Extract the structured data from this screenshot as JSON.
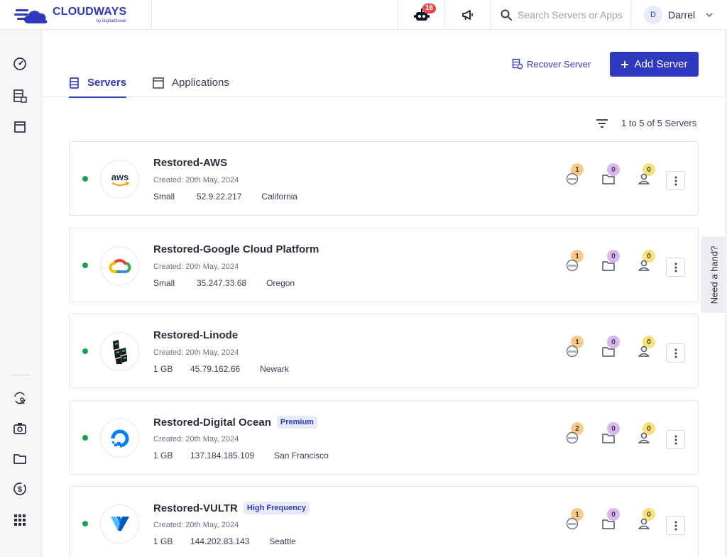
{
  "brand": {
    "name": "CLOUDWAYS",
    "sub": "by DigitalOcean",
    "accent": "#2f39bf"
  },
  "topbar": {
    "notifications_count": "16",
    "search_placeholder": "Search Servers or Apps",
    "user_initial": "D",
    "user_name": "Darrel"
  },
  "sidebar": {
    "items": [
      {
        "icon": "dashboard-gauge-icon"
      },
      {
        "icon": "servers-grid-icon"
      },
      {
        "icon": "applications-window-icon"
      },
      {
        "icon": "team-sync-icon"
      },
      {
        "icon": "addons-camera-icon"
      },
      {
        "icon": "projects-folder-icon"
      },
      {
        "icon": "billing-dollar-icon"
      },
      {
        "icon": "apps-grid-icon"
      }
    ]
  },
  "tabs": [
    {
      "label": "Servers",
      "active": true
    },
    {
      "label": "Applications",
      "active": false
    }
  ],
  "actions": {
    "recover_label": "Recover Server",
    "add_label": "Add Server"
  },
  "pagination": {
    "summary": "1 to 5 of 5 Servers"
  },
  "servers": [
    {
      "name": "Restored-AWS",
      "tag": "",
      "created": "Created: 20th May, 2024",
      "size": "Small",
      "ip": "52.9.22.217",
      "location": "California",
      "provider": "aws",
      "apps": "1",
      "projects": "0",
      "users": "0",
      "status": "running"
    },
    {
      "name": "Restored-Google Cloud Platform",
      "tag": "",
      "created": "Created: 20th May, 2024",
      "size": "Small",
      "ip": "35.247.33.68",
      "location": "Oregon",
      "provider": "gcp",
      "apps": "1",
      "projects": "0",
      "users": "0",
      "status": "running"
    },
    {
      "name": "Restored-Linode",
      "tag": "",
      "created": "Created: 20th May, 2024",
      "size": "1 GB",
      "ip": "45.79.162.66",
      "location": "Newark",
      "provider": "linode",
      "apps": "1",
      "projects": "0",
      "users": "0",
      "status": "running"
    },
    {
      "name": "Restored-Digital Ocean",
      "tag": "Premium",
      "created": "Created: 20th May, 2024",
      "size": "1 GB",
      "ip": "137.184.185.109",
      "location": "San Francisco",
      "provider": "digitalocean",
      "apps": "2",
      "projects": "0",
      "users": "0",
      "status": "running"
    },
    {
      "name": "Restored-VULTR",
      "tag": "High Frequency",
      "created": "Created: 20th May, 2024",
      "size": "1 GB",
      "ip": "144.202.83.143",
      "location": "Seattle",
      "provider": "vultr",
      "apps": "1",
      "projects": "0",
      "users": "0",
      "status": "running"
    }
  ],
  "help": {
    "label": "Need a hand?"
  }
}
